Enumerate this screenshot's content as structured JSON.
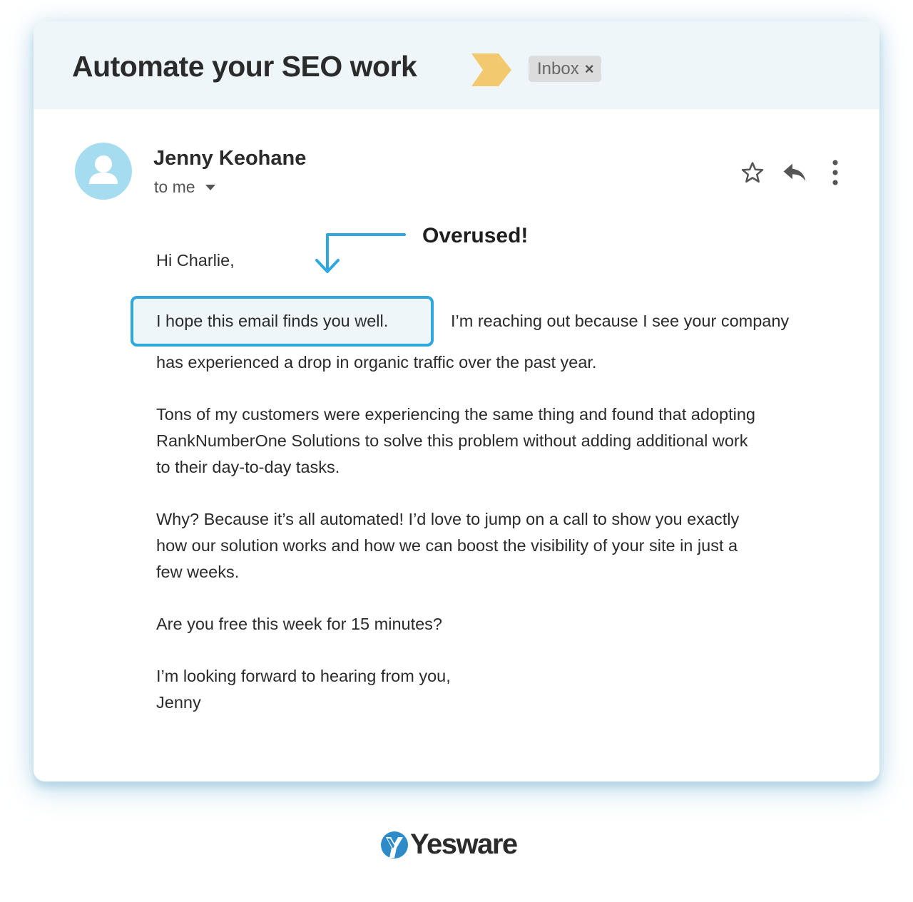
{
  "header": {
    "subject": "Automate your SEO work",
    "importance_icon": "importance-chevron-icon",
    "label": "Inbox",
    "label_remove_icon": "close-icon",
    "label_remove_glyph": "×",
    "importance_color": "#f3c96f",
    "background_color": "#eef6fa"
  },
  "sender": {
    "name": "Jenny Keohane",
    "recipient": "to me",
    "avatar_icon": "person-avatar-icon",
    "avatar_color": "#a6dcf0"
  },
  "actions": [
    {
      "name": "star",
      "icon": "star-icon"
    },
    {
      "name": "reply",
      "icon": "reply-icon"
    },
    {
      "name": "more",
      "icon": "more-vertical-icon"
    }
  ],
  "annotation": {
    "label": "Overused!",
    "color": "#2ea8de"
  },
  "email": {
    "greeting": "Hi Charlie,",
    "highlighted_phrase": "I hope this email finds you well.",
    "p1_rest_line1": "I’m reaching out because I see your company",
    "p1_line2": "has experienced a drop in organic traffic over the past year.",
    "p2_lines": [
      "Tons of my customers were experiencing the same thing and found that adopting",
      "RankNumberOne Solutions to solve this problem without adding additional work",
      "to their day-to-day tasks."
    ],
    "p3_lines": [
      "Why? Because it’s all automated! I’d love to jump on a call to show you exactly",
      "how our solution works and how we can boost the visibility of your site in just a",
      "few weeks."
    ],
    "question": "Are you free this week for 15 minutes?",
    "closing": "I’m looking forward to hearing from you,",
    "signature": "Jenny"
  },
  "branding": {
    "logo_text": "Yesware",
    "logo_color": "#2e8bc9"
  }
}
